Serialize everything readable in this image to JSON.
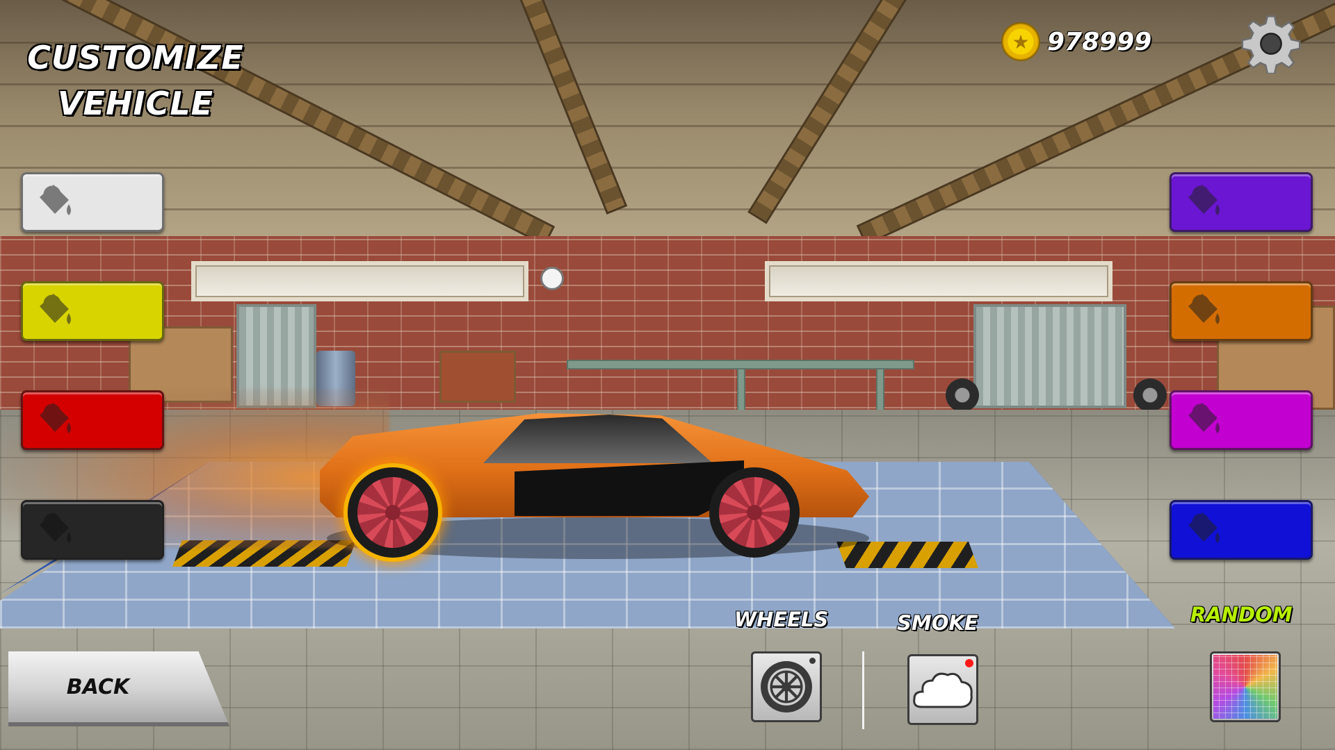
{
  "header": {
    "title_line1": "CUSTOMIZE",
    "title_line2": "VEHICLE"
  },
  "currency": {
    "icon": "coin-icon",
    "amount": "978999"
  },
  "settings": {
    "icon": "gear-icon"
  },
  "colors": {
    "left": [
      {
        "name": "white",
        "hex": "#e6e6e6"
      },
      {
        "name": "yellow",
        "hex": "#d8d400"
      },
      {
        "name": "red",
        "hex": "#d40000"
      },
      {
        "name": "black",
        "hex": "#262626"
      }
    ],
    "right": [
      {
        "name": "purple",
        "hex": "#6a16d2"
      },
      {
        "name": "orange",
        "hex": "#d46d00"
      },
      {
        "name": "magenta",
        "hex": "#c200d0"
      },
      {
        "name": "blue",
        "hex": "#1010d6"
      }
    ],
    "swatch_icon": "paint-bucket-icon"
  },
  "bottom": {
    "back_label": "BACK",
    "wheels_label": "WHEELS",
    "smoke_label": "SMOKE",
    "random_label": "RANDOM",
    "random_color": "#b7f000"
  }
}
